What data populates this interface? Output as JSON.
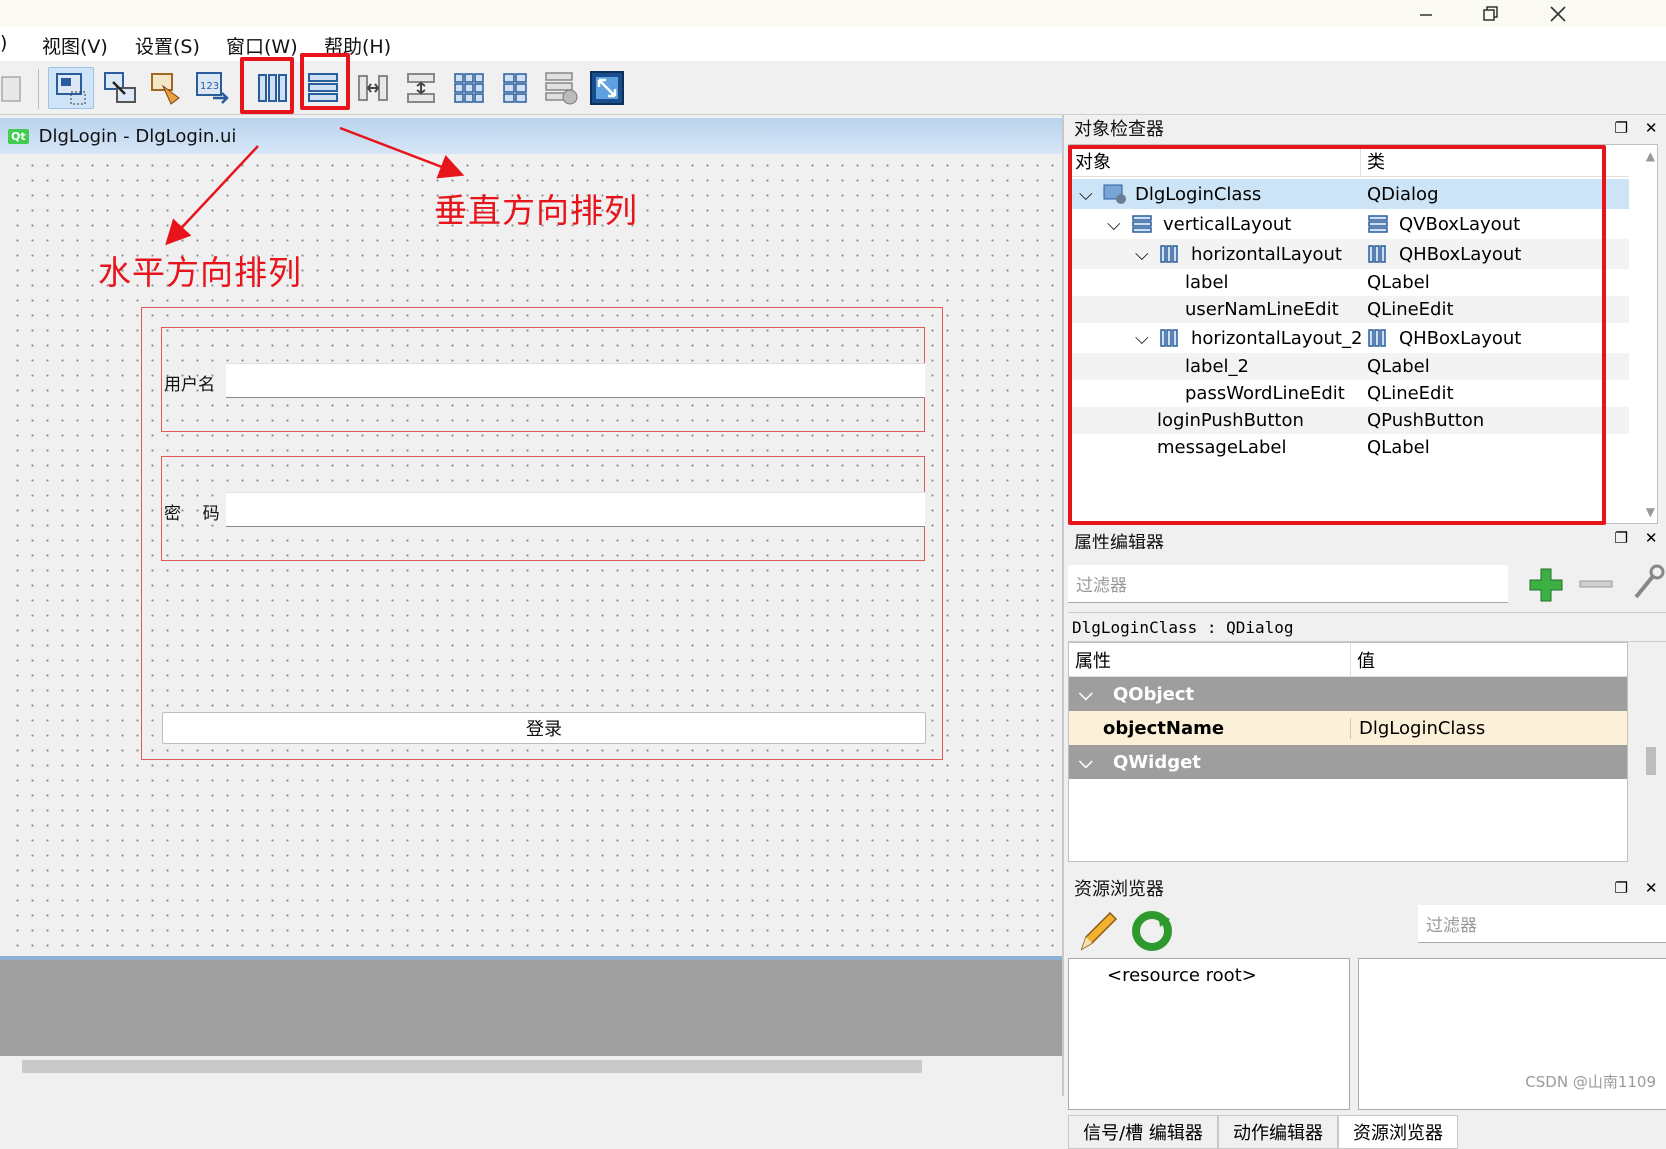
{
  "menu": [
    "视图(V)",
    "设置(S)",
    "窗口(W)",
    "帮助(H)"
  ],
  "menu_cut": ")",
  "form": {
    "window_title": "DlgLogin - DlgLogin.ui",
    "qt_badge": "Qt",
    "username_label": "用户名",
    "password_label": "密    码",
    "login_button": "登录"
  },
  "annotations": {
    "horizontal": "水平方向排列",
    "vertical": "垂直方向排列"
  },
  "object_inspector": {
    "title": "对象检查器",
    "col_object": "对象",
    "col_class": "类",
    "rows": [
      {
        "name": "DlgLoginClass",
        "cls": "QDialog"
      },
      {
        "name": "verticalLayout",
        "cls": "QVBoxLayout"
      },
      {
        "name": "horizontalLayout",
        "cls": "QHBoxLayout"
      },
      {
        "name": "label",
        "cls": "QLabel"
      },
      {
        "name": "userNamLineEdit",
        "cls": "QLineEdit"
      },
      {
        "name": "horizontalLayout_2",
        "cls": "QHBoxLayout"
      },
      {
        "name": "label_2",
        "cls": "QLabel"
      },
      {
        "name": "passWordLineEdit",
        "cls": "QLineEdit"
      },
      {
        "name": "loginPushButton",
        "cls": "QPushButton"
      },
      {
        "name": "messageLabel",
        "cls": "QLabel"
      }
    ]
  },
  "property_editor": {
    "title": "属性编辑器",
    "filter_placeholder": "过滤器",
    "class_line": "DlgLoginClass : QDialog",
    "col_property": "属性",
    "col_value": "值",
    "group1": "QObject",
    "prop_name": "objectName",
    "prop_value": "DlgLoginClass",
    "group2": "QWidget"
  },
  "resource_browser": {
    "title": "资源浏览器",
    "filter_placeholder": "过滤器",
    "root": "<resource root>"
  },
  "bottom_tabs": [
    "信号/槽 编辑器",
    "动作编辑器",
    "资源浏览器"
  ],
  "watermark": "CSDN @山南1109",
  "colors": {
    "highlight": "#e8141b",
    "selection": "#cde4f7",
    "group_row": "#9e9e9e"
  }
}
